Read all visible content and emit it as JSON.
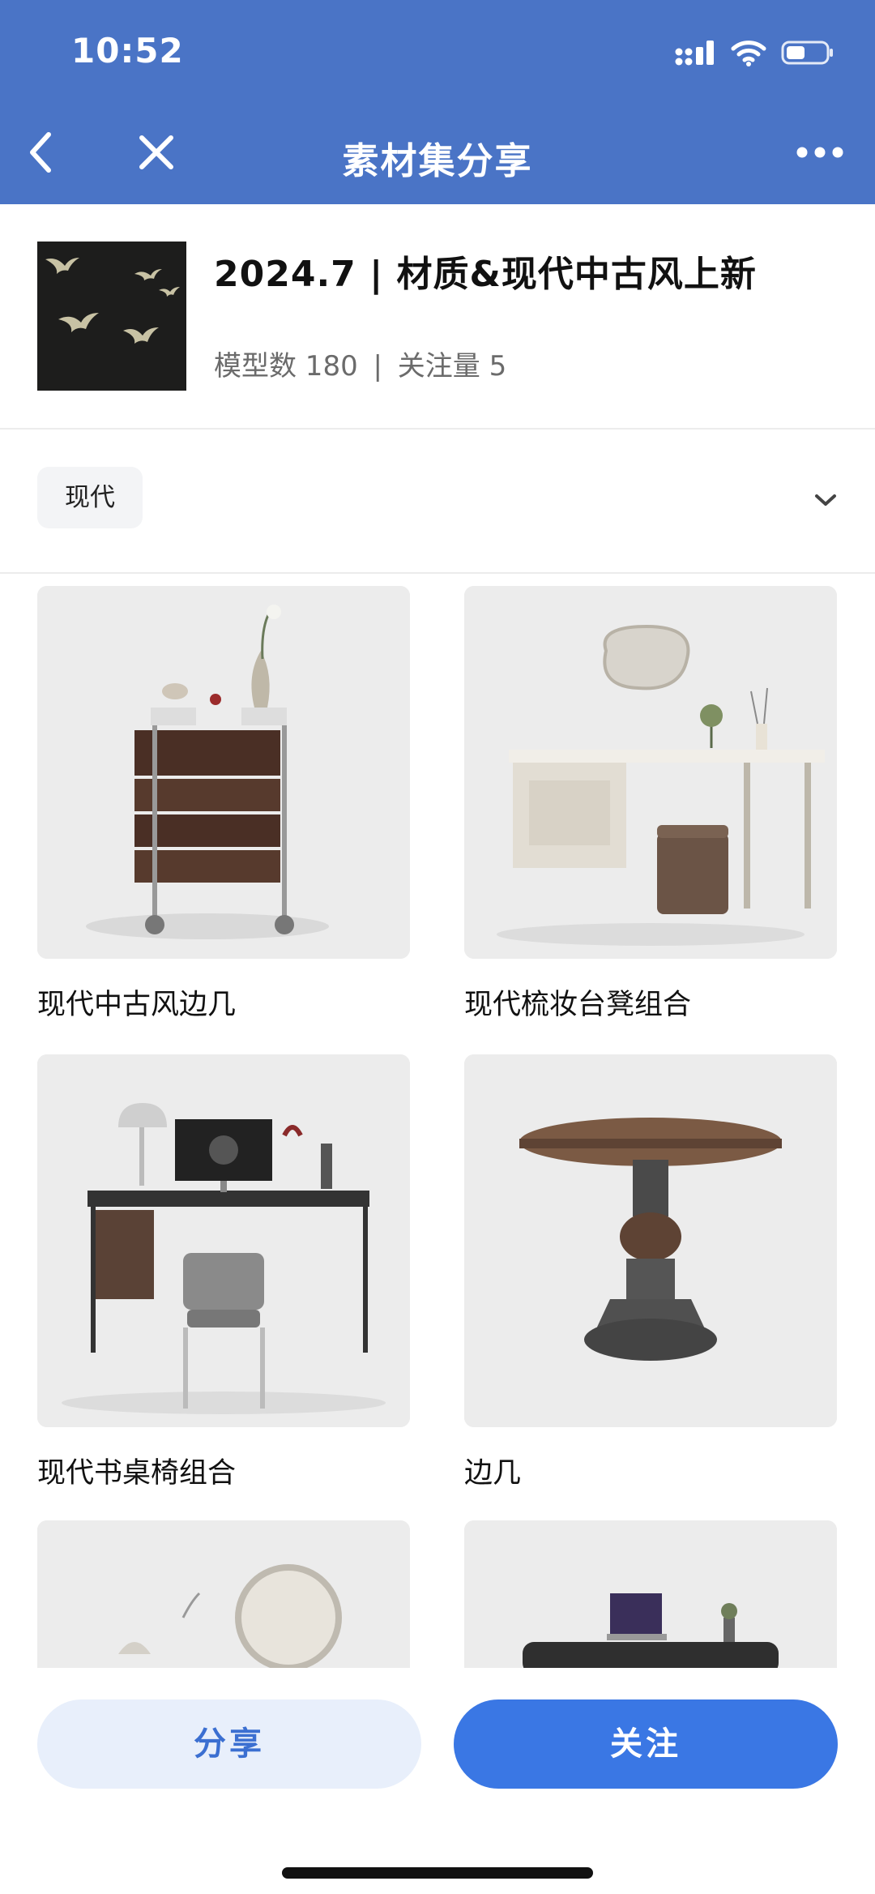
{
  "status_bar": {
    "time": "10:52"
  },
  "nav": {
    "title": "素材集分享"
  },
  "collection": {
    "title": "2024.7 | 材质&现代中古风上新",
    "model_count_label": "模型数 180",
    "separator": "|",
    "follow_count_label": "关注量 5"
  },
  "filter": {
    "selected": "现代"
  },
  "items": [
    {
      "label": "现代中古风边几"
    },
    {
      "label": "现代梳妆台凳组合"
    },
    {
      "label": "现代书桌椅组合"
    },
    {
      "label": "边几"
    }
  ],
  "actions": {
    "share_label": "分享",
    "follow_label": "关注"
  },
  "colors": {
    "header_bg": "#4a74c6",
    "primary_button": "#3a77e4",
    "secondary_button_bg": "#e8effb",
    "secondary_button_text": "#3b6fd1"
  }
}
